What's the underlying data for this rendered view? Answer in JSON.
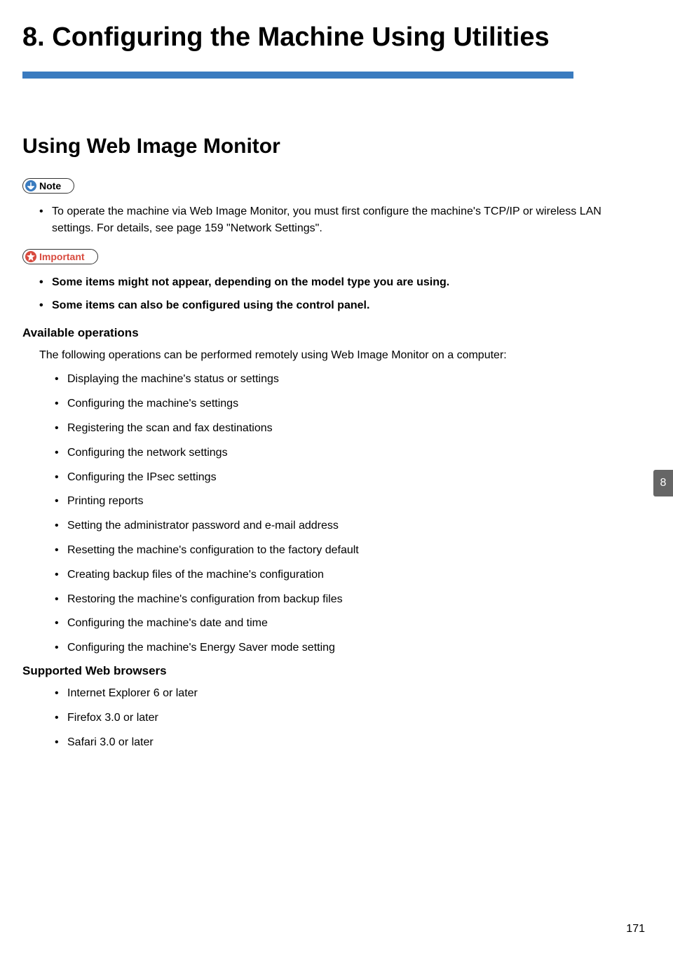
{
  "chapter": {
    "title": "8. Configuring the Machine Using Utilities",
    "tab_number": "8"
  },
  "section": {
    "title": "Using Web Image Monitor"
  },
  "note": {
    "label": "Note",
    "items": [
      "To operate the machine via Web Image Monitor, you must first configure the machine's TCP/IP or wireless LAN settings. For details, see page 159 \"Network Settings\"."
    ]
  },
  "important": {
    "label": "Important",
    "items": [
      "Some items might not appear, depending on the model type you are using.",
      "Some items can also be configured using the control panel."
    ]
  },
  "available_operations": {
    "heading": "Available operations",
    "intro": "The following operations can be performed remotely using Web Image Monitor on a computer:",
    "items": [
      "Displaying the machine's status or settings",
      "Configuring the machine's settings",
      "Registering the scan and fax destinations",
      "Configuring the network settings",
      "Configuring the IPsec settings",
      "Printing reports",
      "Setting the administrator password and e-mail address",
      "Resetting the machine's configuration to the factory default",
      "Creating backup files of the machine's configuration",
      "Restoring the machine's configuration from backup files",
      "Configuring the machine's date and time",
      "Configuring the machine's Energy Saver mode setting"
    ]
  },
  "supported_browsers": {
    "heading": "Supported Web browsers",
    "items": [
      "Internet Explorer 6 or later",
      "Firefox 3.0 or later",
      "Safari 3.0 or later"
    ]
  },
  "page_number": "171"
}
